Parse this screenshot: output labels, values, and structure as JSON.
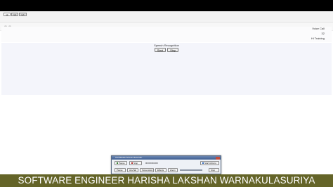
{
  "browser": {
    "tabs": [
      {
        "label": "tab",
        "active": true
      },
      {
        "label": "tab",
        "active": false
      },
      {
        "label": "tab",
        "active": false
      }
    ]
  },
  "status": {
    "lines": [
      "Voice Call",
      "32",
      "Hi Training"
    ]
  },
  "speech": {
    "title": "Speech Recognition",
    "start_label": "Start",
    "stop_label": "Stop"
  },
  "recorder": {
    "title": "CamStudio Screen Recorder",
    "pause_label": "Pause",
    "stop_label": "Stop",
    "timer": "00:00:00.000",
    "start_label": "Start Actions",
    "row2": [
      "Pause",
      "Alt+Tab",
      "Screenshot",
      "Effects",
      "Zoom",
      "Stop"
    ]
  },
  "footer": {
    "text": "SOFTWARE ENGINEER HARISHA LAKSHAN WARNAKULASURIYA"
  },
  "colors": {
    "footer_bg": "#646428",
    "speech_bg": "#f4f5fb",
    "recorder_title": "#3f5e92"
  }
}
